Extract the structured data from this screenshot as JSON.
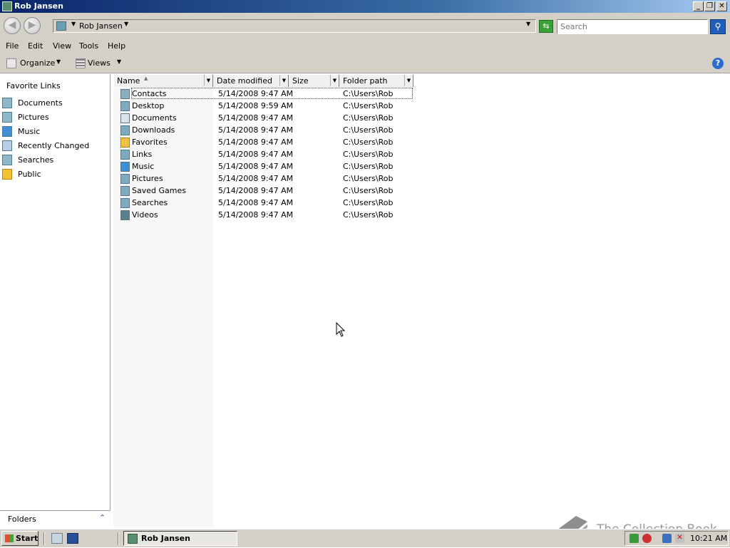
{
  "window": {
    "title": "Rob Jansen",
    "controls": [
      "minimize",
      "restore",
      "close"
    ]
  },
  "address_bar": {
    "breadcrumb": "Rob Jansen",
    "search_placeholder": "Search"
  },
  "menu": {
    "items": [
      "File",
      "Edit",
      "View",
      "Tools",
      "Help"
    ]
  },
  "toolbar": {
    "organize": "Organize",
    "views": "Views",
    "help": "?"
  },
  "sidebar": {
    "title": "Favorite Links",
    "items": [
      {
        "label": "Documents",
        "icon": "documents-icon"
      },
      {
        "label": "Pictures",
        "icon": "pictures-icon"
      },
      {
        "label": "Music",
        "icon": "music-icon"
      },
      {
        "label": "Recently Changed",
        "icon": "recently-changed-icon"
      },
      {
        "label": "Searches",
        "icon": "searches-icon"
      },
      {
        "label": "Public",
        "icon": "public-folder-icon"
      }
    ],
    "folders_label": "Folders"
  },
  "file_list": {
    "columns": [
      "Name",
      "Date modified",
      "Size",
      "Folder path"
    ],
    "rows": [
      {
        "name": "Contacts",
        "date": "5/14/2008 9:47 AM",
        "path": "C:\\Users\\Rob"
      },
      {
        "name": "Desktop",
        "date": "5/14/2008 9:59 AM",
        "path": "C:\\Users\\Rob"
      },
      {
        "name": "Documents",
        "date": "5/14/2008 9:47 AM",
        "path": "C:\\Users\\Rob"
      },
      {
        "name": "Downloads",
        "date": "5/14/2008 9:47 AM",
        "path": "C:\\Users\\Rob"
      },
      {
        "name": "Favorites",
        "date": "5/14/2008 9:47 AM",
        "path": "C:\\Users\\Rob"
      },
      {
        "name": "Links",
        "date": "5/14/2008 9:47 AM",
        "path": "C:\\Users\\Rob"
      },
      {
        "name": "Music",
        "date": "5/14/2008 9:47 AM",
        "path": "C:\\Users\\Rob"
      },
      {
        "name": "Pictures",
        "date": "5/14/2008 9:47 AM",
        "path": "C:\\Users\\Rob"
      },
      {
        "name": "Saved Games",
        "date": "5/14/2008 9:47 AM",
        "path": "C:\\Users\\Rob"
      },
      {
        "name": "Searches",
        "date": "5/14/2008 9:47 AM",
        "path": "C:\\Users\\Rob"
      },
      {
        "name": "Videos",
        "date": "5/14/2008 9:47 AM",
        "path": "C:\\Users\\Rob"
      }
    ]
  },
  "taskbar": {
    "start_label": "Start",
    "window_button": "Rob Jansen",
    "clock": "10:21 AM"
  },
  "watermark": {
    "text": "The Collection Book"
  },
  "colors": {
    "chrome": "#d4d0c8",
    "title_start": "#0a246a",
    "title_end": "#a6caf0"
  }
}
